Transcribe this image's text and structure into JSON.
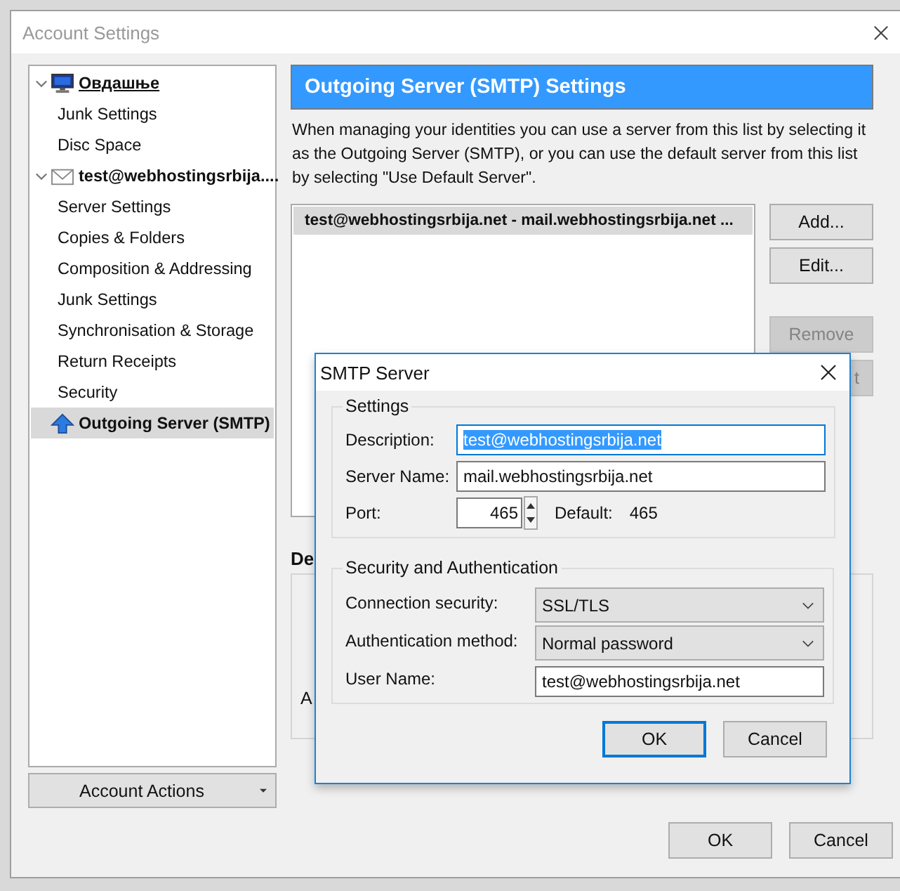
{
  "window": {
    "title": "Account Settings"
  },
  "sidebar": {
    "items": [
      {
        "label": "Овдашње",
        "kind": "local",
        "expanded": true,
        "default_account": true,
        "selected": false,
        "children": [
          {
            "label": "Junk Settings",
            "selected": false
          },
          {
            "label": "Disc Space",
            "selected": false
          }
        ]
      },
      {
        "label": "test@webhostingsrbija....",
        "kind": "mail",
        "expanded": true,
        "default_account": false,
        "selected": false,
        "children": [
          {
            "label": "Server Settings",
            "selected": false
          },
          {
            "label": "Copies & Folders",
            "selected": false
          },
          {
            "label": "Composition & Addressing",
            "selected": false
          },
          {
            "label": "Junk Settings",
            "selected": false
          },
          {
            "label": "Synchronisation & Storage",
            "selected": false
          },
          {
            "label": "Return Receipts",
            "selected": false
          },
          {
            "label": "Security",
            "selected": false
          }
        ]
      },
      {
        "label": "Outgoing Server (SMTP)",
        "kind": "smtp",
        "selected": true
      }
    ]
  },
  "account_actions": "Account Actions",
  "panel": {
    "header": "Outgoing Server (SMTP) Settings",
    "description": "When managing your identities you can use a server from this list by selecting it as the Outgoing Server (SMTP), or you can use the default server from this list by selecting \"Use Default Server\".",
    "servers": [
      {
        "label": "test@webhostingsrbija.net - mail.webhostingsrbija.net ...",
        "selected": true
      }
    ],
    "buttons": [
      {
        "label": "Add...",
        "disabled": false
      },
      {
        "label": "Edit...",
        "disabled": false
      },
      {
        "label": "Remove",
        "disabled": true
      },
      {
        "label": "t",
        "disabled": true
      }
    ],
    "details_heading": "De",
    "details_label": "A"
  },
  "buttons": [
    {
      "label": "OK"
    },
    {
      "label": "Cancel"
    }
  ],
  "dialog": {
    "title": "SMTP Server",
    "settings": {
      "legend": "Settings",
      "description_label": "Description:",
      "description_value": "test@webhostingsrbija.net",
      "description_selected": true,
      "server_name_label": "Server Name:",
      "server_name_value": "mail.webhostingsrbija.net",
      "port_label": "Port:",
      "port_value": "465",
      "default_label": "Default:",
      "default_value": "465"
    },
    "security": {
      "legend": "Security and Authentication",
      "connection_label": "Connection security:",
      "connection_value": "SSL/TLS",
      "auth_label": "Authentication method:",
      "auth_value": "Normal password",
      "user_label": "User Name:",
      "user_value": "test@webhostingsrbija.net"
    },
    "buttons": [
      {
        "label": "OK",
        "default": true
      },
      {
        "label": "Cancel",
        "default": false
      }
    ]
  }
}
